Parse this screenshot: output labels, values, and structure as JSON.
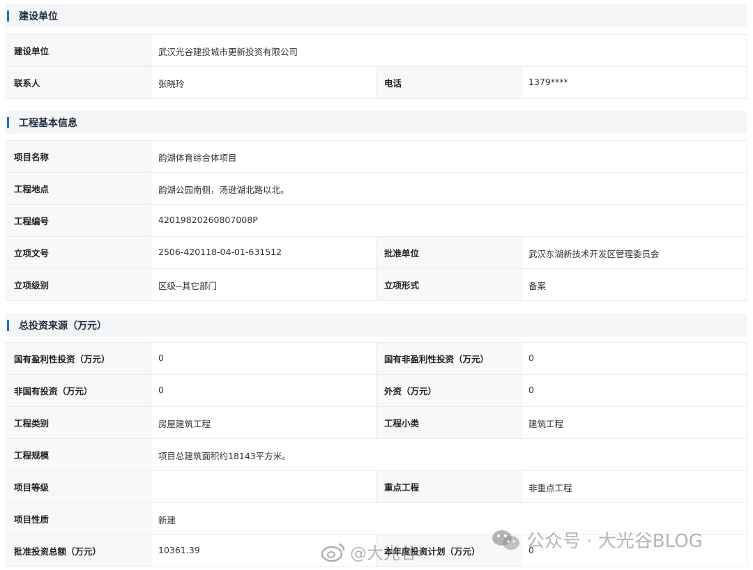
{
  "sections": {
    "builder": {
      "title": "建设单位",
      "rows": [
        {
          "label1": "建设单位",
          "value1": "武汉光谷建投城市更新投资有限公司"
        },
        {
          "label1": "联系人",
          "value1": "张晓玲",
          "label2": "电话",
          "value2": "1379****"
        }
      ]
    },
    "basic": {
      "title": "工程基本信息",
      "rows": [
        {
          "label1": "项目名称",
          "value1": "韵湖体育综合体项目"
        },
        {
          "label1": "工程地点",
          "value1": "韵湖公园南侧，汤逊湖北路以北。"
        },
        {
          "label1": "工程编号",
          "value1": "42019820260807008P"
        },
        {
          "label1": "立项文号",
          "value1": "2506-420118-04-01-631512",
          "label2": "批准单位",
          "value2": "武汉东湖新技术开发区管理委员会"
        },
        {
          "label1": "立项级别",
          "value1": "区级--其它部门",
          "label2": "立项形式",
          "value2": "备案"
        }
      ]
    },
    "invest": {
      "title": "总投资来源（万元）",
      "rows": [
        {
          "label1": "国有盈利性投资（万元）",
          "value1": "0",
          "label2": "国有非盈利性投资（万元）",
          "value2": "0"
        },
        {
          "label1": "非国有投资（万元）",
          "value1": "0",
          "label2": "外资（万元）",
          "value2": "0"
        },
        {
          "label1": "工程类别",
          "value1": "房屋建筑工程",
          "label2": "工程小类",
          "value2": "建筑工程"
        },
        {
          "label1": "工程规模",
          "value1": "项目总建筑面积约18143平方米。"
        },
        {
          "label1": "项目等级",
          "value1": "",
          "label2": "重点工程",
          "value2": "非重点工程"
        },
        {
          "label1": "项目性质",
          "value1": "新建"
        },
        {
          "label1": "批准投资总额（万元）",
          "value1": "10361.39",
          "label2": "本年度投资计划（万元）",
          "value2": "0"
        }
      ]
    }
  },
  "watermarks": {
    "wechat": "公众号 · 大光谷BLOG",
    "weibo": "@大光谷"
  }
}
